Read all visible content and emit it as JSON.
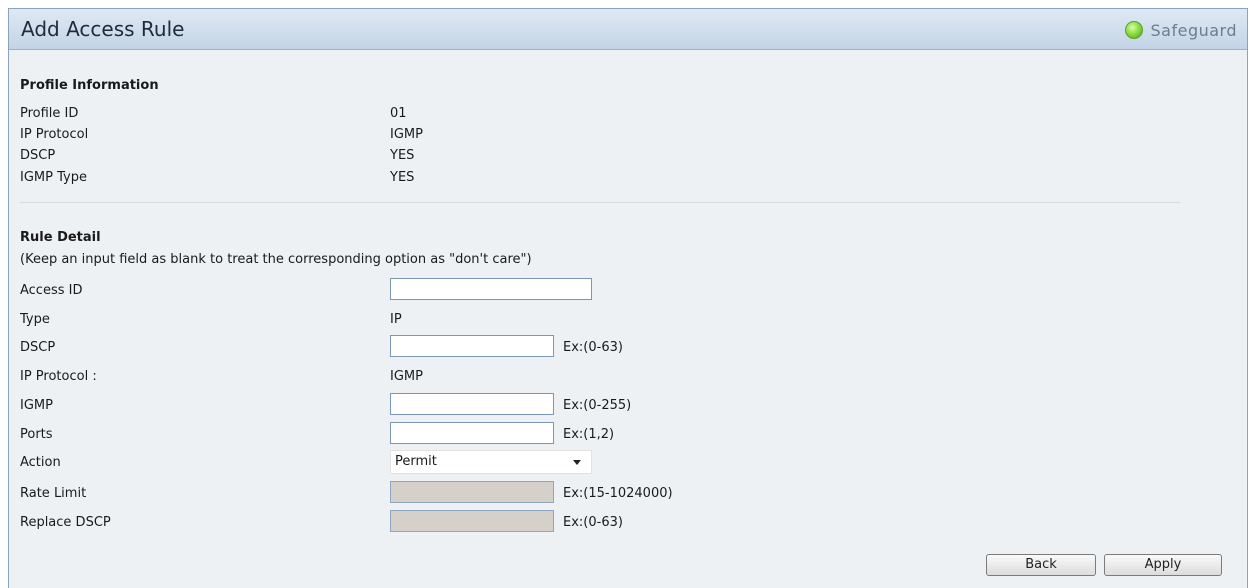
{
  "window": {
    "title": "Add Access Rule",
    "status_label": "Safeguard",
    "status_color": "#7fd33a"
  },
  "profile": {
    "section_title": "Profile Information",
    "rows": [
      {
        "label": "Profile ID",
        "value": "01"
      },
      {
        "label": "IP Protocol",
        "value": "IGMP"
      },
      {
        "label": "DSCP",
        "value": "YES"
      },
      {
        "label": "IGMP Type",
        "value": "YES"
      }
    ]
  },
  "rule": {
    "section_title": "Rule Detail",
    "note": "(Keep an input field as blank to treat the corresponding option as \"don't care\")",
    "access_id": {
      "label": "Access ID",
      "value": ""
    },
    "type": {
      "label": "Type",
      "value": "IP"
    },
    "dscp": {
      "label": "DSCP",
      "value": "",
      "hint": "Ex:(0-63)"
    },
    "ip_protocol": {
      "label": "IP Protocol :",
      "value": "IGMP"
    },
    "igmp": {
      "label": "IGMP",
      "value": "",
      "hint": "Ex:(0-255)"
    },
    "ports": {
      "label": "Ports",
      "value": "",
      "hint": "Ex:(1,2)"
    },
    "action": {
      "label": "Action",
      "selected": "Permit"
    },
    "rate_limit": {
      "label": "Rate Limit",
      "value": "",
      "hint": "Ex:(15-1024000)"
    },
    "replace_dscp": {
      "label": "Replace DSCP",
      "value": "",
      "hint": "Ex:(0-63)"
    }
  },
  "buttons": {
    "back": "Back",
    "apply": "Apply"
  }
}
